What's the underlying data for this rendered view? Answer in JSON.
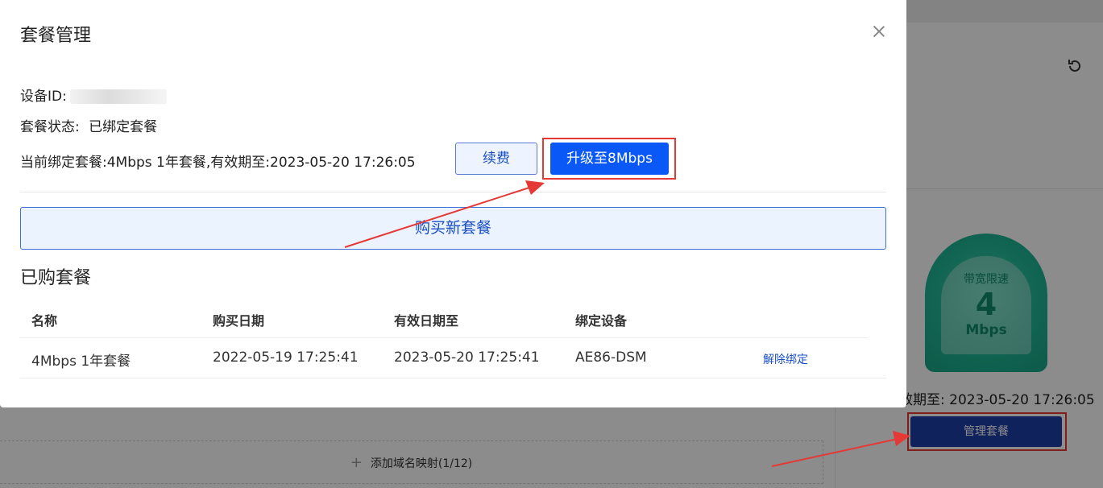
{
  "modal": {
    "title": "套餐管理",
    "device_id_label": "设备ID:",
    "status_label": "套餐状态:",
    "status_value": "已绑定套餐",
    "current_plan_label": "当前绑定套餐:",
    "current_plan_text": "4Mbps 1年套餐,有效期至:2023-05-20 17:26:05",
    "renew_label": "续费",
    "upgrade_label": "升级至8Mbps",
    "buy_new_label": "购买新套餐",
    "purchased_title": "已购套餐",
    "table": {
      "headers": [
        "名称",
        "购买日期",
        "有效日期至",
        "绑定设备"
      ],
      "rows": [
        {
          "name": "4Mbps 1年套餐",
          "purchase_date": "2022-05-19 17:25:41",
          "expiry": "2023-05-20 17:25:41",
          "device": "AE86-DSM",
          "action": "解除绑定"
        }
      ]
    }
  },
  "background": {
    "gauge": {
      "title": "带宽限速",
      "value": "4",
      "unit": "Mbps"
    },
    "expiry_text": "效期至: 2023-05-20 17:26:05",
    "manage_button": "管理套餐",
    "add_mapping": "添加域名映射(1/12)"
  },
  "colors": {
    "primary": "#0a58f5",
    "highlight": "#e53935",
    "gauge": "#1fb795",
    "manage_button": "#1e3fa8"
  }
}
